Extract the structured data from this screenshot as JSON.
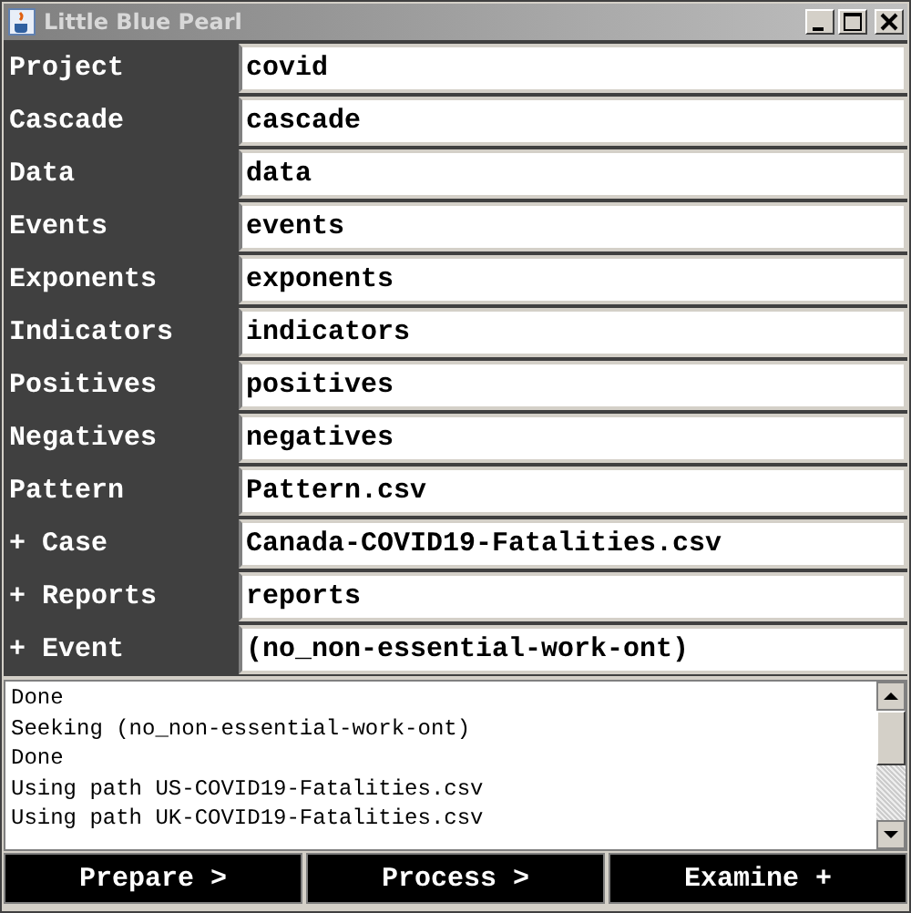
{
  "window": {
    "title": "Little Blue Pearl"
  },
  "fields": [
    {
      "label": "Project",
      "value": "covid"
    },
    {
      "label": "Cascade",
      "value": "cascade"
    },
    {
      "label": "Data",
      "value": "data"
    },
    {
      "label": "Events",
      "value": "events"
    },
    {
      "label": "Exponents",
      "value": "exponents"
    },
    {
      "label": "Indicators",
      "value": "indicators"
    },
    {
      "label": "Positives",
      "value": "positives"
    },
    {
      "label": "Negatives",
      "value": "negatives"
    },
    {
      "label": "Pattern",
      "value": "Pattern.csv"
    },
    {
      "label": "+ Case",
      "value": "Canada-COVID19-Fatalities.csv"
    },
    {
      "label": "+ Reports",
      "value": "reports"
    },
    {
      "label": "+ Event",
      "value": "(no_non-essential-work-ont)"
    }
  ],
  "log": [
    "Done",
    "Seeking (no_non-essential-work-ont)",
    "Done",
    "Using path US-COVID19-Fatalities.csv",
    "Using path UK-COVID19-Fatalities.csv"
  ],
  "buttons": [
    "Prepare >",
    "Process >",
    "Examine +"
  ]
}
